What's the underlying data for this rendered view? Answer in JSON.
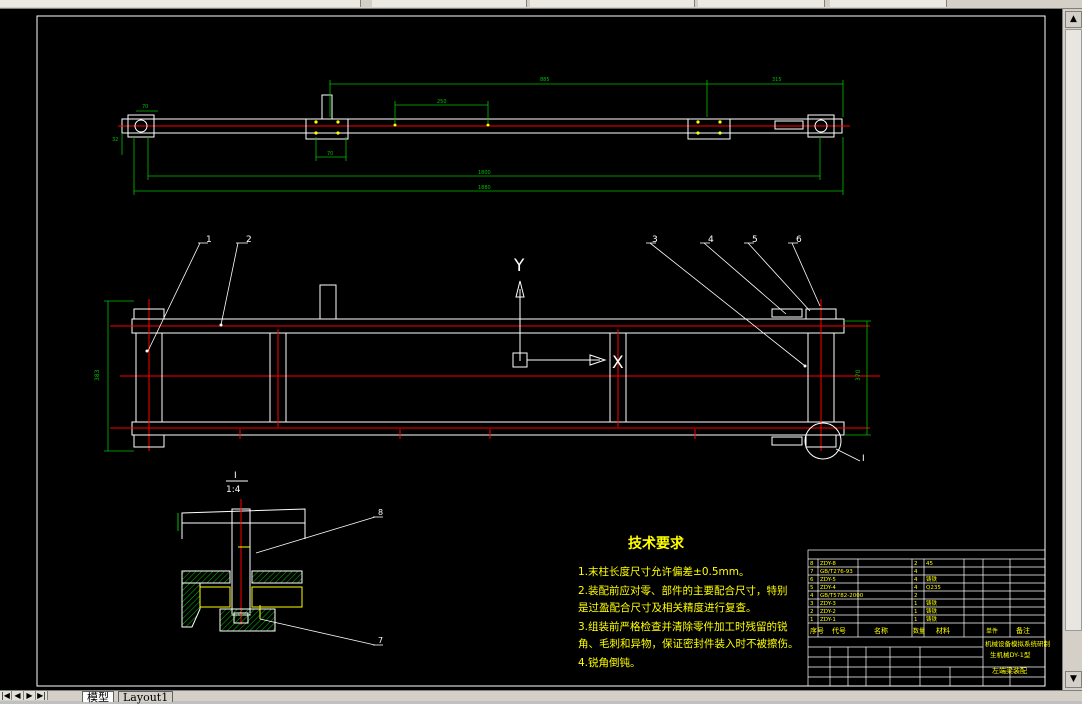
{
  "drawing": {
    "top_view": {
      "dims": {
        "d885": "885",
        "d315": "315",
        "d250": "250",
        "d70a": "70",
        "d70b": "70",
        "d32": "32",
        "d1800": "1800",
        "d1880": "1880"
      }
    },
    "front_view": {
      "axis_y": "Y",
      "axis_x": "X",
      "dim_left": "383",
      "dim_right": "370",
      "balloons": [
        "1",
        "2",
        "3",
        "4",
        "5",
        "6",
        "I"
      ]
    },
    "detail": {
      "label": "I",
      "scale": "1:4",
      "balloons": [
        "8",
        "7"
      ]
    },
    "tech_requirements": {
      "title": "技术要求",
      "items": [
        "1.末柱长度尺寸允许偏差±0.5mm。",
        "2.装配前应对零、部件的主要配合尺寸，特别",
        "是过盈配合尺寸及相关精度进行复查。",
        "3.组装前严格检查并清除零件加工时残留的锐",
        "角、毛刺和异物，保证密封件装入时不被擦伤。",
        "4.锐角倒钝。"
      ]
    },
    "parts_list": {
      "rows": [
        {
          "no": "8",
          "code": "ZDY-8",
          "name": "",
          "qty": "2",
          "mat": "45"
        },
        {
          "no": "7",
          "code": "GB/T276-93",
          "name": "",
          "qty": "4",
          "mat": ""
        },
        {
          "no": "6",
          "code": "ZDY-5",
          "name": "",
          "qty": "4",
          "mat": "铸铁"
        },
        {
          "no": "5",
          "code": "ZDY-4",
          "name": "",
          "qty": "4",
          "mat": "Q235"
        },
        {
          "no": "4",
          "code": "GB/T5782-2000",
          "name": "",
          "qty": "2",
          "mat": ""
        },
        {
          "no": "3",
          "code": "ZDY-3",
          "name": "",
          "qty": "1",
          "mat": "铸铁"
        },
        {
          "no": "2",
          "code": "ZDY-2",
          "name": "",
          "qty": "1",
          "mat": "铸铁"
        },
        {
          "no": "1",
          "code": "ZDY-1",
          "name": "",
          "qty": "1",
          "mat": "铸铁"
        }
      ],
      "header": {
        "no": "序号",
        "code": "代号",
        "name": "名称",
        "qty": "数量",
        "mat": "材料",
        "unit_wt": "单件",
        "note": "备注"
      }
    },
    "title_block": {
      "title_line1": "机械设备模拟系统研制",
      "title_line2": "生机械DY-1型",
      "drawing_name": "左端梁装配"
    }
  },
  "layout_tabs": {
    "model_tab": "模型",
    "layout_tab": "Layout1"
  },
  "colors": {
    "background": "#000000",
    "line_white": "#ffffff",
    "center_red": "#ff0000",
    "dim_green": "#00c000",
    "text_yellow": "#ffff00"
  }
}
